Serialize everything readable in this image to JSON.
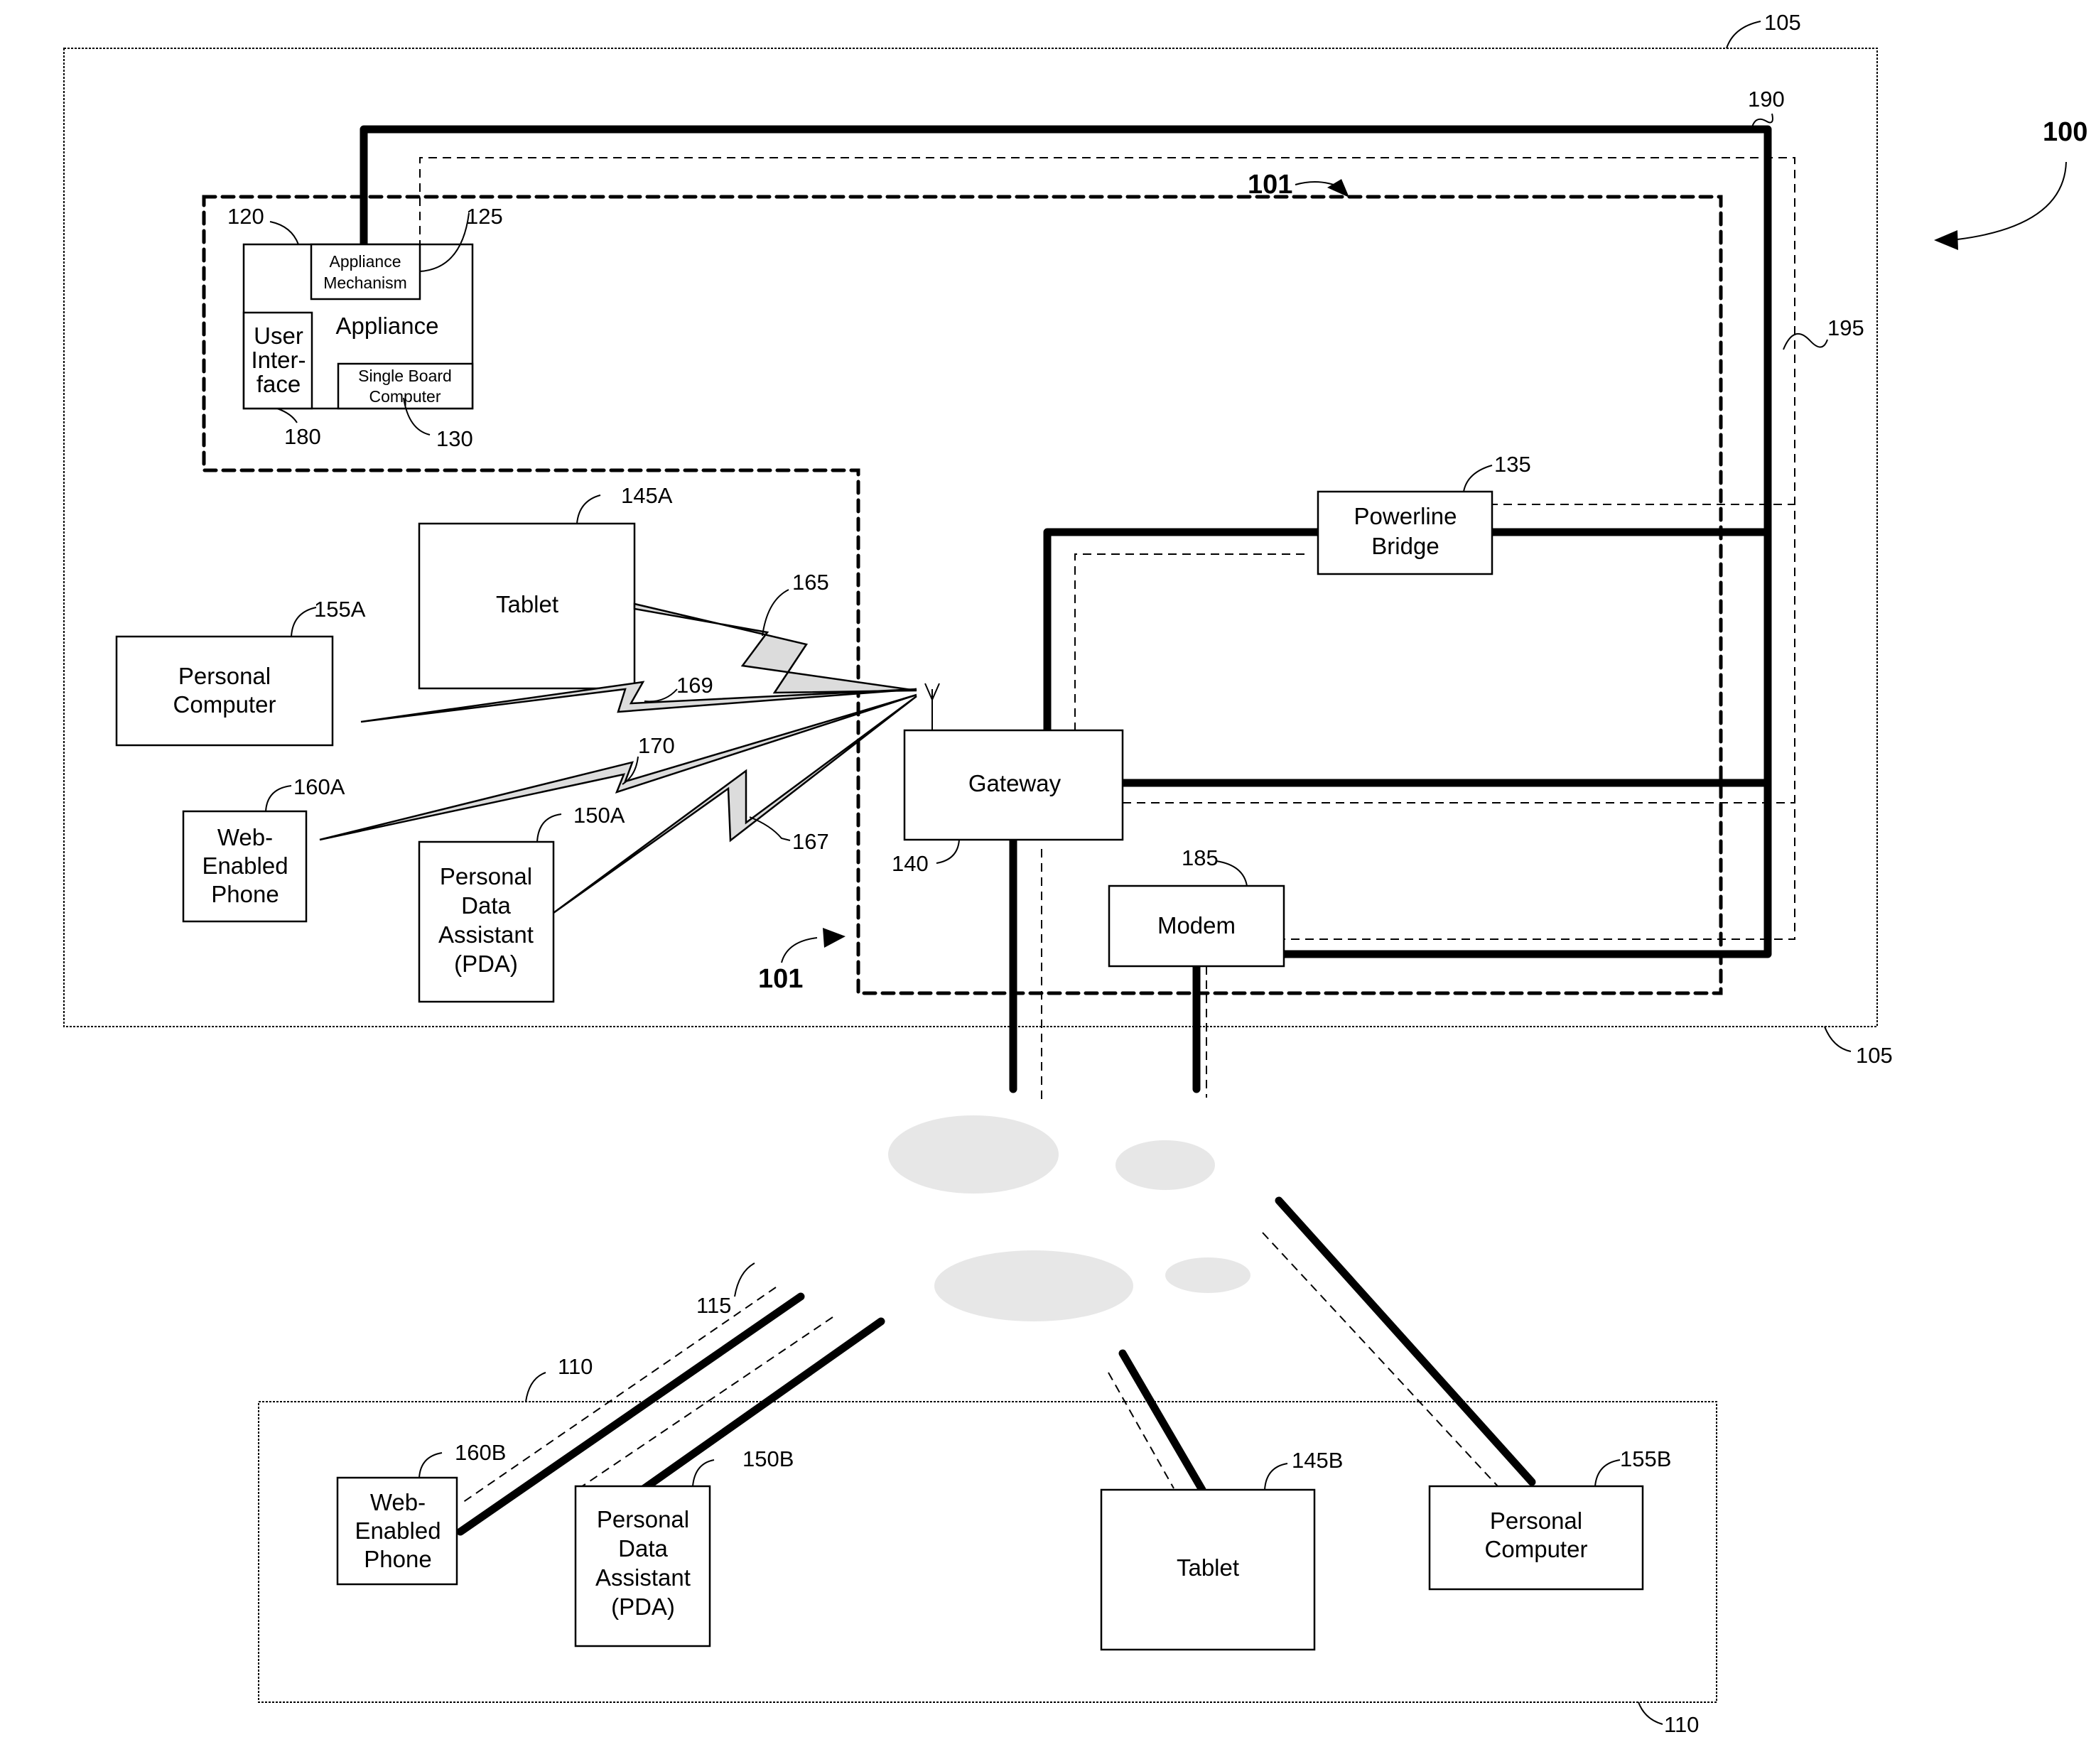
{
  "figure": {
    "system_ref": "100",
    "premises_ref": "105",
    "remote_ref": "110",
    "network_ref": "115",
    "home_network_ref": "101",
    "power_line_ref": "190",
    "data_line_ref": "195"
  },
  "appliance": {
    "ref": "120",
    "label": "Appliance",
    "mechanism": {
      "ref": "125",
      "line1": "Appliance",
      "line2": "Mechanism"
    },
    "user_interface": {
      "ref": "180",
      "line1": "User",
      "line2": "Inter-",
      "line3": "face"
    },
    "sbc": {
      "ref": "130",
      "line1": "Single Board",
      "line2": "Computer"
    }
  },
  "infrastructure": {
    "powerline_bridge": {
      "ref": "135",
      "line1": "Powerline",
      "line2": "Bridge"
    },
    "gateway": {
      "ref": "140",
      "label": "Gateway"
    },
    "modem": {
      "ref": "185",
      "label": "Modem"
    }
  },
  "local_devices": {
    "tablet": {
      "ref": "145A",
      "label": "Tablet"
    },
    "pc": {
      "ref": "155A",
      "line1": "Personal",
      "line2": "Computer"
    },
    "phone": {
      "ref": "160A",
      "line1": "Web-",
      "line2": "Enabled",
      "line3": "Phone"
    },
    "pda": {
      "ref": "150A",
      "line1": "Personal",
      "line2": "Data",
      "line3": "Assistant",
      "line4": "(PDA)"
    }
  },
  "wireless_links": {
    "tablet_link": "165",
    "pda_link": "167",
    "pc_link": "169",
    "phone_link": "170"
  },
  "remote_devices": {
    "phone": {
      "ref": "160B",
      "line1": "Web-",
      "line2": "Enabled",
      "line3": "Phone"
    },
    "pda": {
      "ref": "150B",
      "line1": "Personal",
      "line2": "Data",
      "line3": "Assistant",
      "line4": "(PDA)"
    },
    "tablet": {
      "ref": "145B",
      "label": "Tablet"
    },
    "pc": {
      "ref": "155B",
      "line1": "Personal",
      "line2": "Computer"
    }
  }
}
